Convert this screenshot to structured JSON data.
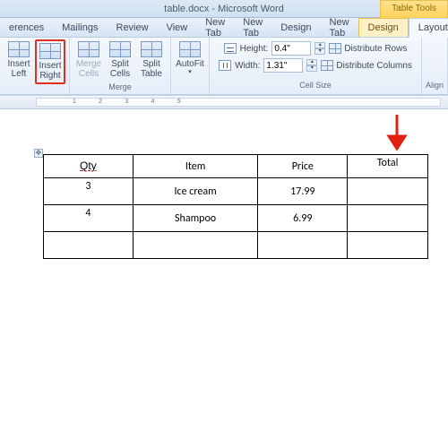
{
  "title": "table.docx - Microsoft Word",
  "tool_tab": "Table Tools",
  "tabs": [
    "erences",
    "Mailings",
    "Review",
    "View",
    "New Tab",
    "New Tab",
    "Design",
    "New Tab",
    "Design",
    "Layout"
  ],
  "active_context_tab": "Design",
  "active_tab": "Layout",
  "ribbon": {
    "rows_cols": {
      "insert_left": "Insert\nLeft",
      "insert_right": "Insert\nRight"
    },
    "merge": {
      "merge_cells": "Merge\nCells",
      "split_cells": "Split\nCells",
      "split_table": "Split\nTable",
      "title": "Merge"
    },
    "autofit": "AutoFit",
    "cell_size": {
      "height_label": "Height:",
      "height_value": "0.4\"",
      "width_label": "Width:",
      "width_value": "1.31\"",
      "dist_rows": "Distribute Rows",
      "dist_cols": "Distribute Columns",
      "title": "Cell Size"
    },
    "align_title": "Align"
  },
  "table": {
    "headers": [
      "Qty",
      "Item",
      "Price",
      "Total"
    ],
    "rows": [
      {
        "qty": "3",
        "item": "Ice cream",
        "price": "17.99",
        "total": ""
      },
      {
        "qty": "4",
        "item": "Shampoo",
        "price": "6.99",
        "total": ""
      },
      {
        "qty": "",
        "item": "",
        "price": "",
        "total": ""
      }
    ]
  }
}
